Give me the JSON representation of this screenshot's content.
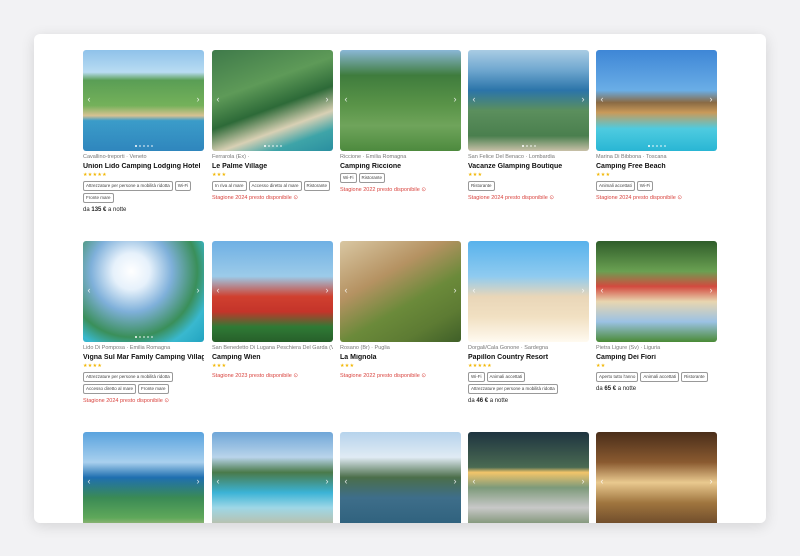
{
  "cards": [
    {
      "location": "Cavallino-treporti · Veneto",
      "name": "Union Lido Camping Lodging Hotel",
      "stars": "★★★★★",
      "tags": [
        "Attrezzature per persone a mobilità ridotta",
        "Wi-Fi",
        "Fronte mare"
      ],
      "season": "",
      "price_prefix": "da",
      "price": "135 €",
      "price_suffix": "a notte"
    },
    {
      "location": "Ferrarola (Ex) ·",
      "name": "Le Palme Village",
      "stars": "★★★",
      "tags": [
        "In riva al mare",
        "Accesso diretto al mare",
        "Ristorante"
      ],
      "season": "Stagione 2024 presto disponibile",
      "price_prefix": "",
      "price": "",
      "price_suffix": ""
    },
    {
      "location": "Riccione · Emilia Romagna",
      "name": "Camping Riccione",
      "stars": "",
      "tags": [
        "Wi-Fi",
        "Ristorante"
      ],
      "season": "Stagione 2022 presto disponibile",
      "price_prefix": "",
      "price": "",
      "price_suffix": ""
    },
    {
      "location": "San Felice Del Benaco · Lombardia",
      "name": "Vacanze Glamping Boutique",
      "stars": "★★★",
      "tags": [
        "Ristorante"
      ],
      "season": "Stagione 2024 presto disponibile",
      "price_prefix": "",
      "price": "",
      "price_suffix": ""
    },
    {
      "location": "Marina Di Bibbona · Toscana",
      "name": "Camping Free Beach",
      "stars": "★★★",
      "tags": [
        "Animali accettati",
        "Wi-Fi"
      ],
      "season": "Stagione 2024 presto disponibile",
      "price_prefix": "",
      "price": "",
      "price_suffix": ""
    },
    {
      "location": "Lido Di Pomposa · Emilia Romagna",
      "name": "Vigna Sul Mar Family Camping Village",
      "stars": "★★★★",
      "tags": [
        "Attrezzature per persone a mobilità ridotta",
        "Accesso diretto al mare",
        "Fronte mare"
      ],
      "season": "Stagione 2024 presto disponibile",
      "price_prefix": "",
      "price": "",
      "price_suffix": ""
    },
    {
      "location": "San Benedetto Di Lugana Peschiera Del Garda (Vr) · Veneto",
      "name": "Camping Wien",
      "stars": "★★★",
      "tags": [],
      "season": "Stagione 2023 presto disponibile",
      "price_prefix": "",
      "price": "",
      "price_suffix": ""
    },
    {
      "location": "Rosano (Br) · Puglia",
      "name": "La Mignola",
      "stars": "★★★",
      "tags": [],
      "season": "Stagione 2022 presto disponibile",
      "price_prefix": "",
      "price": "",
      "price_suffix": ""
    },
    {
      "location": "Dorgali/Cala Gonone · Sardegna",
      "name": "Papillon Country Resort",
      "stars": "★★★★★",
      "tags": [
        "Wi-Fi",
        "Animali accettati",
        "Attrezzature per persone a mobilità ridotta"
      ],
      "season": "",
      "price_prefix": "da",
      "price": "46 €",
      "price_suffix": "a notte"
    },
    {
      "location": "Pietra Ligure (Sv) · Liguria",
      "name": "Camping Dei Fiori",
      "stars": "★★",
      "tags": [
        "Aperto tutto l'anno",
        "Animali accettati",
        "Ristorante"
      ],
      "season": "",
      "price_prefix": "da",
      "price": "65 €",
      "price_suffix": "a notte"
    },
    {
      "location": "",
      "name": "",
      "stars": "",
      "tags": [],
      "season": "",
      "price_prefix": "",
      "price": "",
      "price_suffix": ""
    },
    {
      "location": "",
      "name": "",
      "stars": "",
      "tags": [],
      "season": "",
      "price_prefix": "",
      "price": "",
      "price_suffix": ""
    },
    {
      "location": "",
      "name": "",
      "stars": "",
      "tags": [],
      "season": "",
      "price_prefix": "",
      "price": "",
      "price_suffix": ""
    },
    {
      "location": "",
      "name": "",
      "stars": "",
      "tags": [],
      "season": "",
      "price_prefix": "",
      "price": "",
      "price_suffix": ""
    },
    {
      "location": "",
      "name": "",
      "stars": "",
      "tags": [],
      "season": "",
      "price_prefix": "",
      "price": "",
      "price_suffix": ""
    }
  ],
  "colors": {
    "accent_red": "#d9443f",
    "star_yellow": "#f2b705"
  },
  "icons": {
    "prev": "chevron-left-icon",
    "next": "chevron-right-icon"
  }
}
